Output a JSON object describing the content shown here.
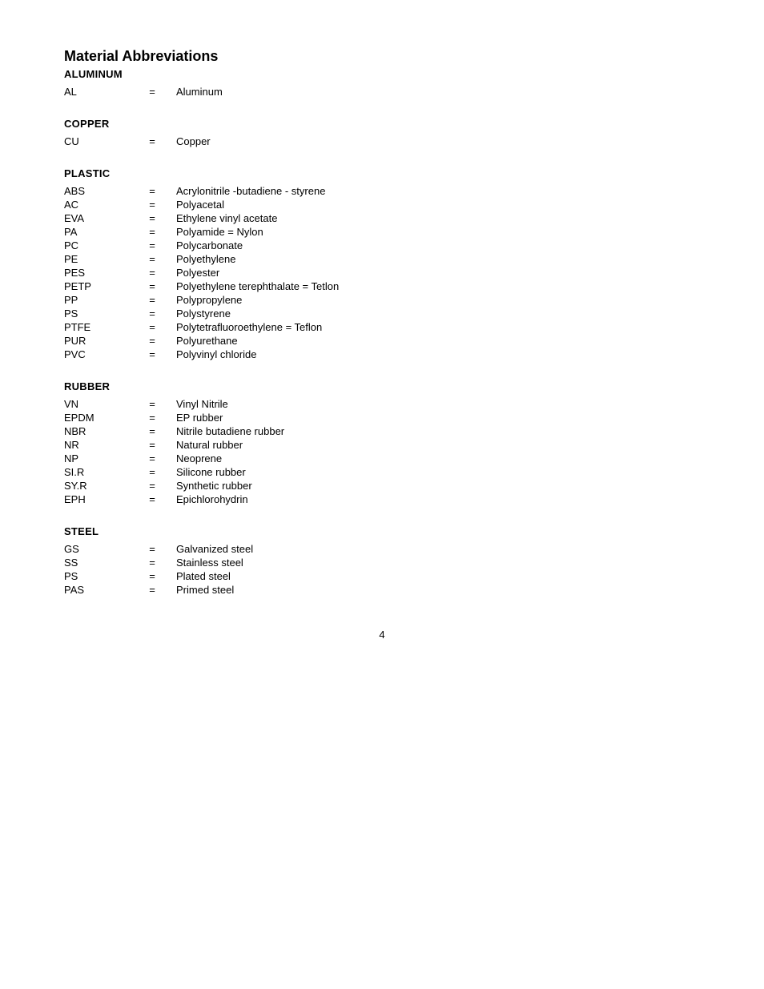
{
  "page": {
    "title": "Material Abbreviations",
    "page_number": "4",
    "sections": [
      {
        "id": "aluminum",
        "title": "ALUMINUM",
        "items": [
          {
            "abbr": "AL",
            "eq": "=",
            "name": "Aluminum"
          }
        ]
      },
      {
        "id": "copper",
        "title": "COPPER",
        "items": [
          {
            "abbr": "CU",
            "eq": "=",
            "name": "Copper"
          }
        ]
      },
      {
        "id": "plastic",
        "title": "PLASTIC",
        "items": [
          {
            "abbr": "ABS",
            "eq": "=",
            "name": "Acrylonitrile -butadiene - styrene"
          },
          {
            "abbr": "AC",
            "eq": "=",
            "name": "Polyacetal"
          },
          {
            "abbr": "EVA",
            "eq": "=",
            "name": "Ethylene vinyl acetate"
          },
          {
            "abbr": "PA",
            "eq": "=",
            "name": "Polyamide = Nylon"
          },
          {
            "abbr": "PC",
            "eq": "=",
            "name": "Polycarbonate"
          },
          {
            "abbr": "PE",
            "eq": "=",
            "name": "Polyethylene"
          },
          {
            "abbr": "PES",
            "eq": "=",
            "name": "Polyester"
          },
          {
            "abbr": "PETP",
            "eq": "=",
            "name": "Polyethylene terephthalate = Tetlon"
          },
          {
            "abbr": "PP",
            "eq": "=",
            "name": "Polypropylene"
          },
          {
            "abbr": "PS",
            "eq": "=",
            "name": "Polystyrene"
          },
          {
            "abbr": "PTFE",
            "eq": "=",
            "name": "Polytetrafluoroethylene = Teflon"
          },
          {
            "abbr": "PUR",
            "eq": "=",
            "name": "Polyurethane"
          },
          {
            "abbr": "PVC",
            "eq": "=",
            "name": "Polyvinyl chloride"
          }
        ]
      },
      {
        "id": "rubber",
        "title": "RUBBER",
        "items": [
          {
            "abbr": "VN",
            "eq": "=",
            "name": "Vinyl Nitrile"
          },
          {
            "abbr": "EPDM",
            "eq": "=",
            "name": "EP rubber"
          },
          {
            "abbr": "NBR",
            "eq": "=",
            "name": "Nitrile butadiene rubber"
          },
          {
            "abbr": "NR",
            "eq": "=",
            "name": "Natural rubber"
          },
          {
            "abbr": "NP",
            "eq": "=",
            "name": "Neoprene"
          },
          {
            "abbr": "SI.R",
            "eq": "=",
            "name": "Silicone rubber"
          },
          {
            "abbr": "SY.R",
            "eq": "=",
            "name": "Synthetic rubber"
          },
          {
            "abbr": "EPH",
            "eq": "=",
            "name": "Epichlorohydrin"
          }
        ]
      },
      {
        "id": "steel",
        "title": "STEEL",
        "items": [
          {
            "abbr": "GS",
            "eq": "=",
            "name": "Galvanized steel"
          },
          {
            "abbr": "SS",
            "eq": "=",
            "name": "Stainless steel"
          },
          {
            "abbr": "PS",
            "eq": "=",
            "name": "Plated steel"
          },
          {
            "abbr": "PAS",
            "eq": "=",
            "name": "Primed steel"
          }
        ]
      }
    ]
  }
}
